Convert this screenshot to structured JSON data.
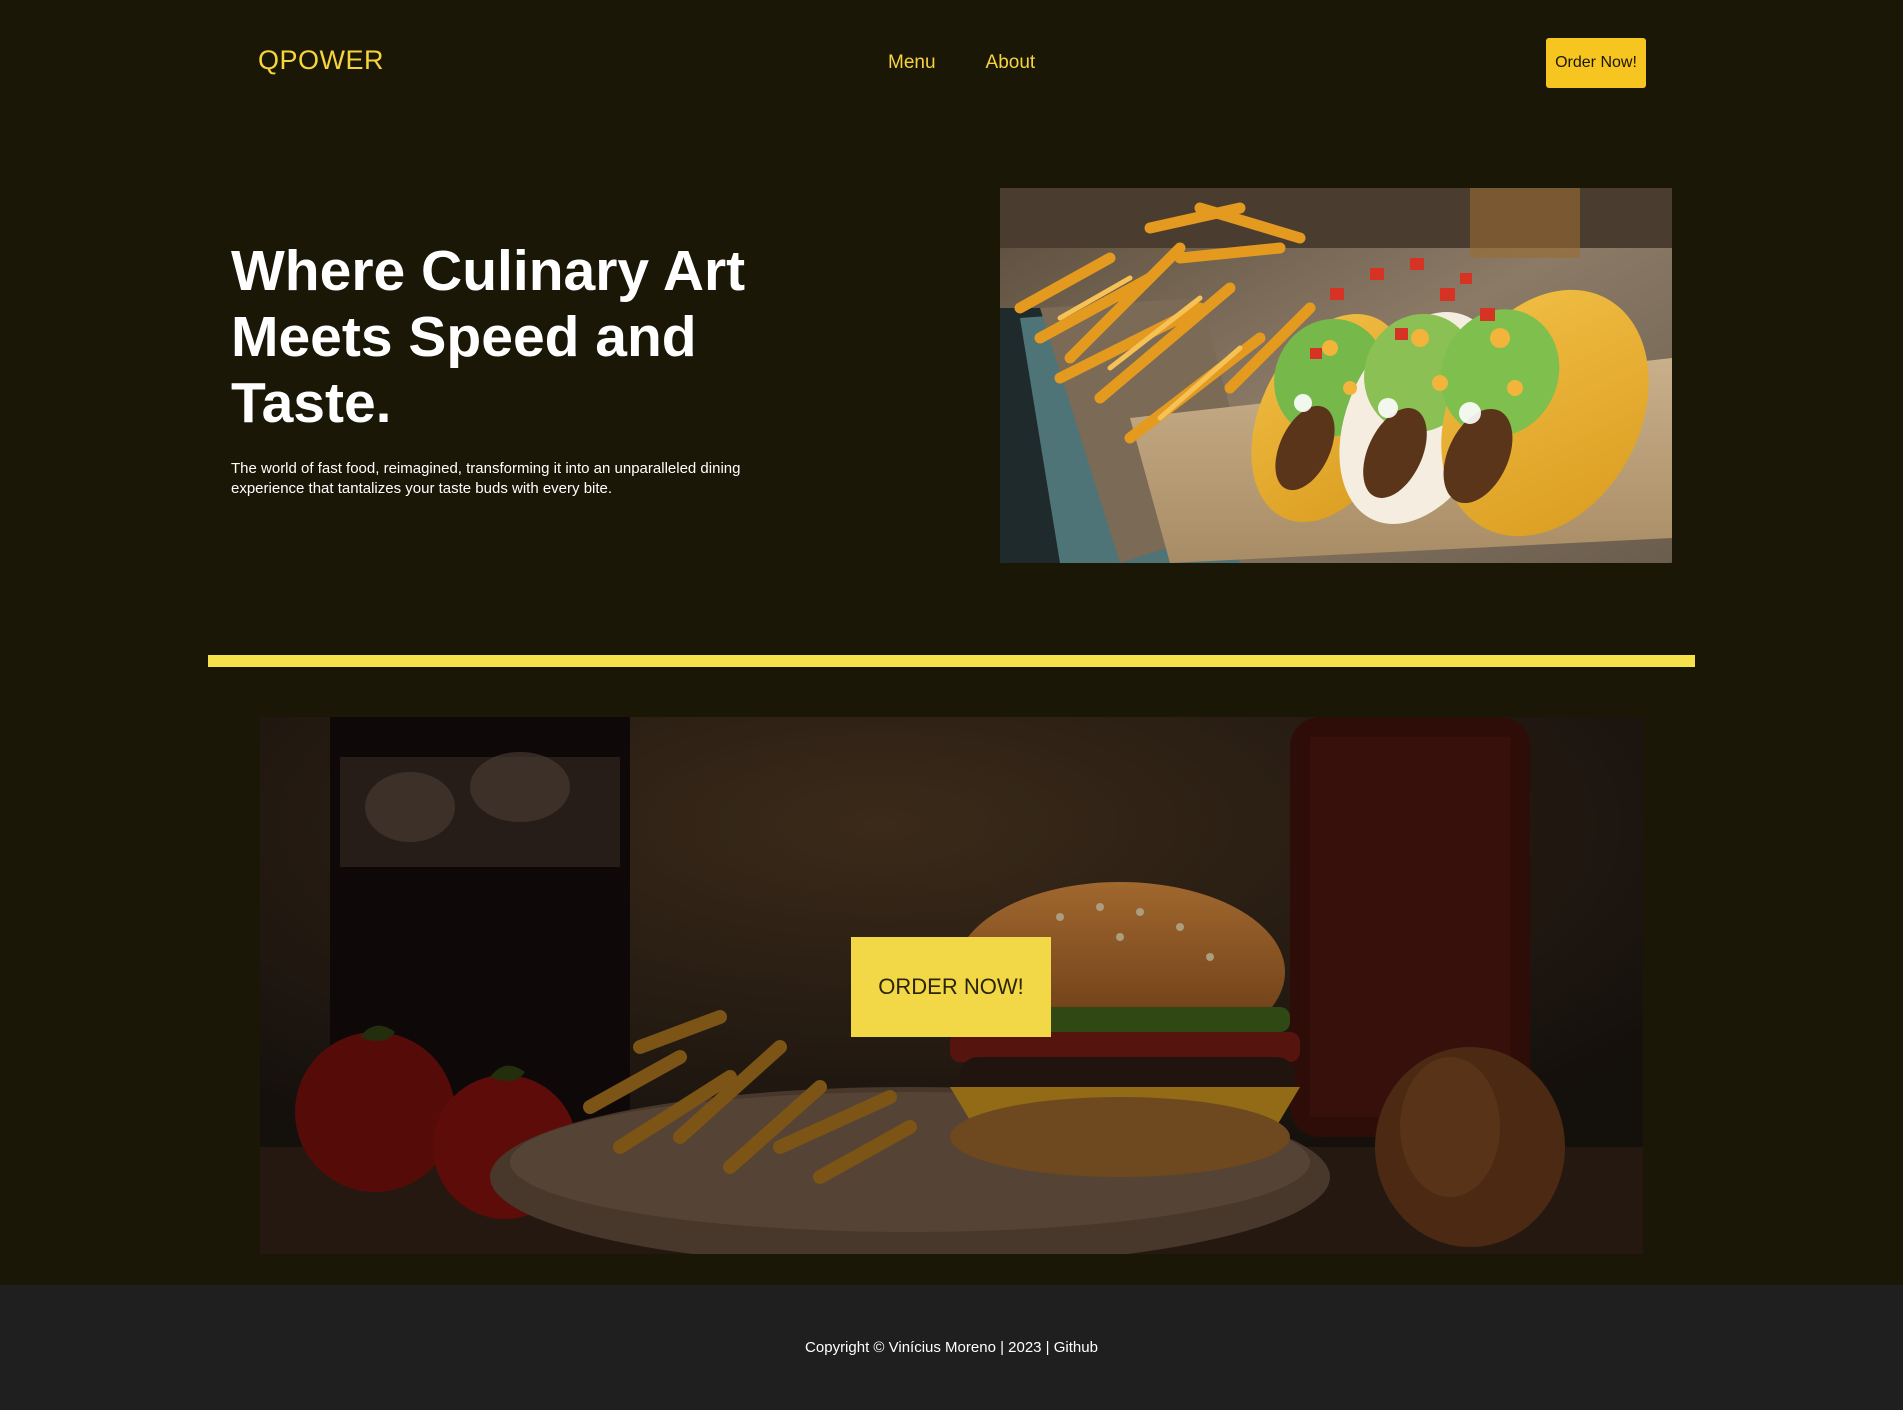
{
  "header": {
    "logo": "QPOWER",
    "nav": [
      {
        "label": "Menu"
      },
      {
        "label": "About"
      }
    ],
    "order_button": "Order Now!"
  },
  "hero": {
    "title_lines": [
      "Where Culinary Art",
      "Meets Speed and",
      "Taste."
    ],
    "text": "The world of fast food, reimagined, transforming it into an unparalleled dining experience that tantalizes your taste buds with every bite.",
    "image_alt": "Tacos and fries photo"
  },
  "banner": {
    "button_label": "ORDER NOW!",
    "image_alt": "Burger, fries, cola, tomatoes and onion photo"
  },
  "footer": {
    "copyright": "Copyright © Vinícius Moreno | 2023 |",
    "link": "Github"
  },
  "colors": {
    "background": "#1a1706",
    "accent": "#f6d43c",
    "button": "#f6c51f",
    "divider": "#f6e14a",
    "footer": "#1f1f1f"
  }
}
